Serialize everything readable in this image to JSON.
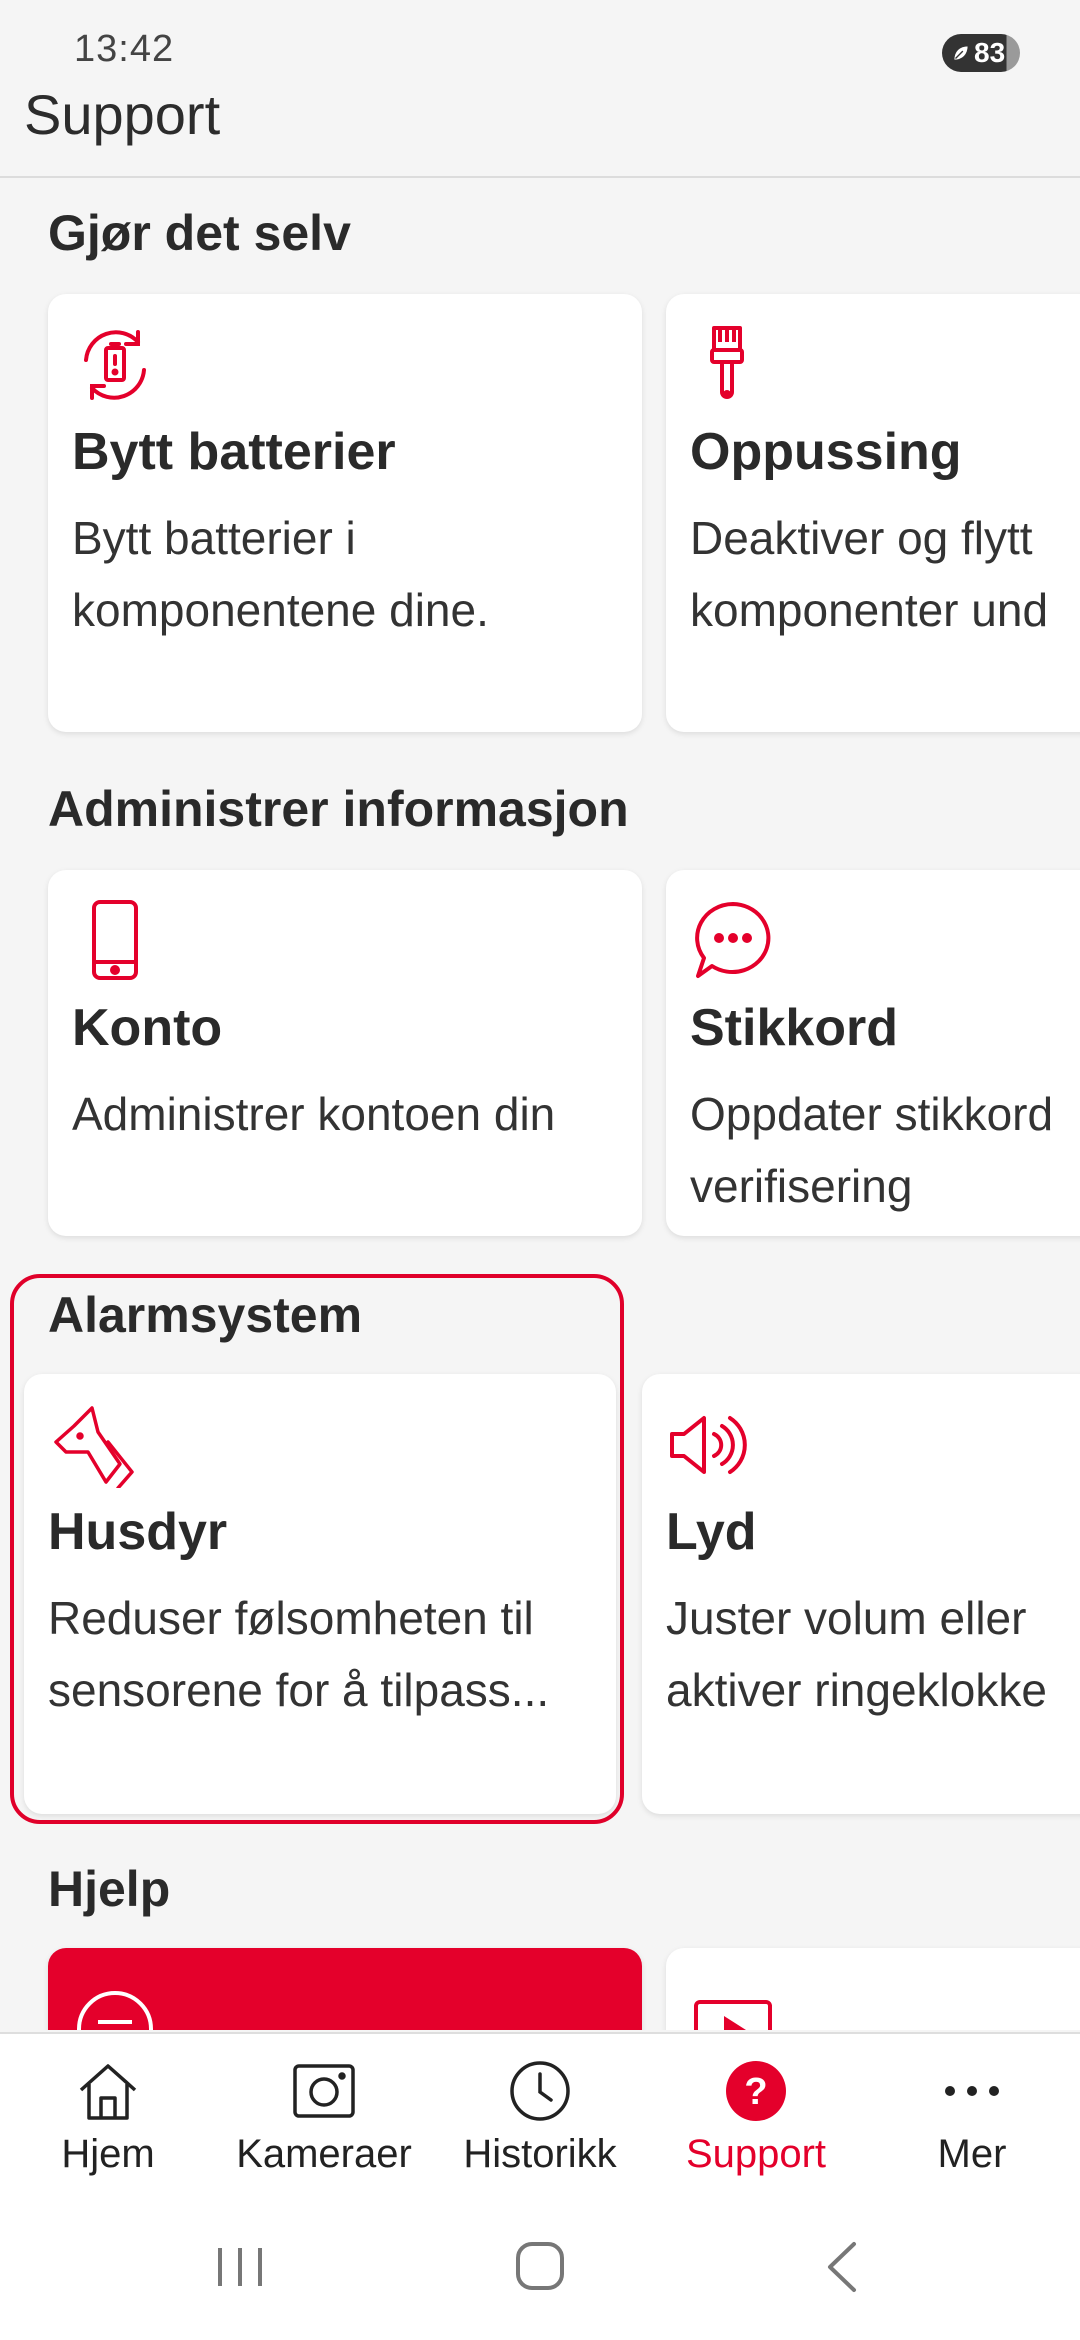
{
  "status_bar": {
    "time": "13:42",
    "battery": "83"
  },
  "header": {
    "title": "Support"
  },
  "sections": {
    "diy": {
      "title": "Gjør det selv",
      "cards": [
        {
          "title": "Bytt batterier",
          "desc_line1": "Bytt batterier i",
          "desc_line2": "komponentene dine.",
          "icon": "battery-swap-icon"
        },
        {
          "title": "Oppussing",
          "desc_line1": "Deaktiver og flytt",
          "desc_line2": "komponenter und",
          "icon": "paintbrush-icon"
        }
      ]
    },
    "admin": {
      "title": "Administrer informasjon",
      "cards": [
        {
          "title": "Konto",
          "desc_line1": "Administrer kontoen din",
          "icon": "phone-icon"
        },
        {
          "title": "Stikkord",
          "desc_line1": "Oppdater stikkord",
          "desc_line2": "verifisering",
          "icon": "chat-bubble-icon"
        }
      ]
    },
    "alarm": {
      "title": "Alarmsystem",
      "cards": [
        {
          "title": "Husdyr",
          "desc_line1": "Reduser følsomheten til",
          "desc_line2": "sensorene for å tilpass...",
          "icon": "pet-dog-icon"
        },
        {
          "title": "Lyd",
          "desc_line1": "Juster volum eller",
          "desc_line2": "aktiver ringeklokke",
          "icon": "speaker-icon"
        }
      ]
    },
    "help": {
      "title": "Hjelp"
    }
  },
  "bottom_nav": {
    "items": [
      {
        "label": "Hjem",
        "icon": "home-icon"
      },
      {
        "label": "Kameraer",
        "icon": "camera-icon"
      },
      {
        "label": "Historikk",
        "icon": "clock-icon"
      },
      {
        "label": "Support",
        "icon": "help-icon",
        "active": true
      },
      {
        "label": "Mer",
        "icon": "more-icon"
      }
    ]
  },
  "colors": {
    "accent": "#e4002b",
    "background": "#f5f5f5",
    "card": "#ffffff"
  }
}
